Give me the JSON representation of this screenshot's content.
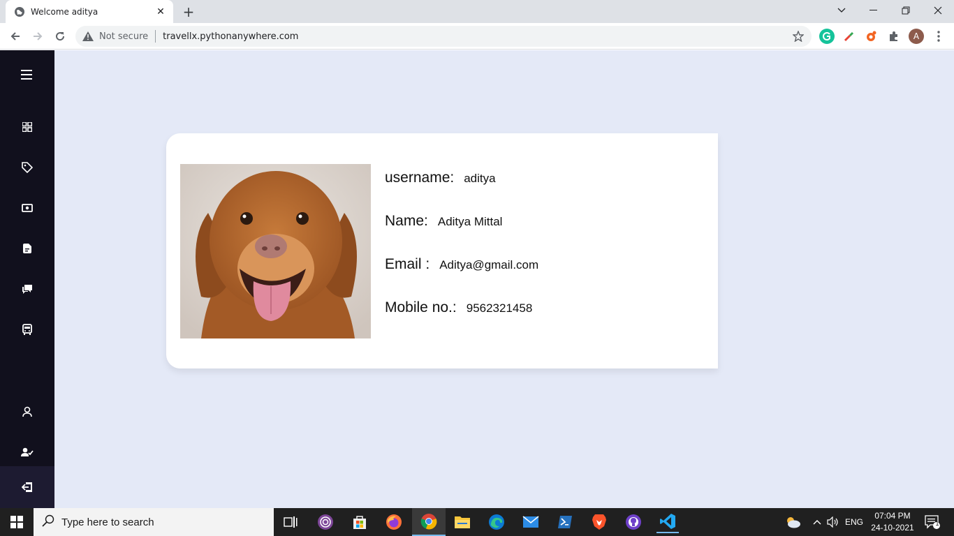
{
  "browser": {
    "tab_title": "Welcome aditya",
    "new_tab": "+",
    "security_label": "Not secure",
    "url": "travellx.pythonanywhere.com",
    "profile_initial": "A"
  },
  "profile": {
    "fields": [
      {
        "label": "username:",
        "value": "aditya"
      },
      {
        "label": "Name:",
        "value": "Aditya Mittal"
      },
      {
        "label": "Email :",
        "value": "Aditya@gmail.com"
      },
      {
        "label": "Mobile no.:",
        "value": "9562321458"
      }
    ]
  },
  "sidebar": {
    "items": [
      "menu-icon",
      "grid-icon",
      "tag-icon",
      "wallet-icon",
      "file-icon",
      "chat-icon",
      "bus-icon",
      "user-icon",
      "user-check-icon",
      "logout-icon"
    ]
  },
  "taskbar": {
    "search_placeholder": "Type here to search",
    "language": "ENG",
    "time": "07:04 PM",
    "date": "24-10-2021",
    "notification_count": "1"
  },
  "colors": {
    "page_bg": "#e4e9f7",
    "sidebar_bg": "#11101d",
    "card_bg": "#ffffff"
  }
}
